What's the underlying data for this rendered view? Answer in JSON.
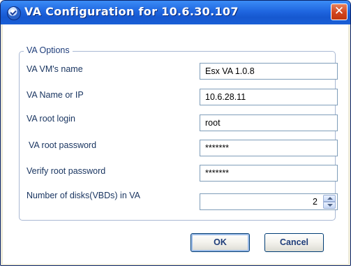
{
  "window": {
    "title": "VA Configuration for  10.6.30.107",
    "close_glyph": "✕",
    "accent": "#1f66e0"
  },
  "group": {
    "legend": "VA Options"
  },
  "fields": {
    "vm_name": {
      "label": "VA VM's name",
      "value": "Esx VA 1.0.8"
    },
    "name_or_ip": {
      "label": "VA Name or IP",
      "value": "10.6.28.11"
    },
    "root_login": {
      "label": "VA root login",
      "value": "root"
    },
    "root_password": {
      "label": "VA root password",
      "value": "*******"
    },
    "verify_password": {
      "label": "Verify root password",
      "value": "*******"
    },
    "num_disks": {
      "label": "Number of disks(VBDs) in VA",
      "value": "2"
    }
  },
  "buttons": {
    "ok": "OK",
    "cancel": "Cancel"
  }
}
